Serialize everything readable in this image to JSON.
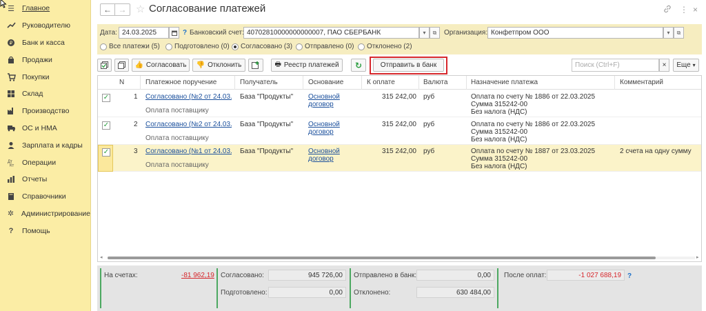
{
  "sidebar": {
    "items": [
      {
        "label": "Главное",
        "icon": "menu-icon"
      },
      {
        "label": "Руководителю",
        "icon": "trend-icon"
      },
      {
        "label": "Банк и касса",
        "icon": "bank-icon"
      },
      {
        "label": "Продажи",
        "icon": "bag-icon"
      },
      {
        "label": "Покупки",
        "icon": "cart-icon"
      },
      {
        "label": "Склад",
        "icon": "warehouse-icon"
      },
      {
        "label": "Производство",
        "icon": "factory-icon"
      },
      {
        "label": "ОС и НМА",
        "icon": "truck-icon"
      },
      {
        "label": "Зарплата и кадры",
        "icon": "person-icon"
      },
      {
        "label": "Операции",
        "icon": "operations-icon"
      },
      {
        "label": "Отчеты",
        "icon": "chart-icon"
      },
      {
        "label": "Справочники",
        "icon": "book-icon"
      },
      {
        "label": "Администрирование",
        "icon": "gear-icon"
      },
      {
        "label": "Помощь",
        "icon": "question-icon"
      }
    ]
  },
  "header": {
    "title": "Согласование платежей",
    "back": "←",
    "forward": "→",
    "star": "☆",
    "link_glyph": "🔗",
    "more_glyph": "⋮",
    "close_glyph": "×"
  },
  "filter": {
    "date_label": "Дата:",
    "date_value": "24.03.2025",
    "help": "?",
    "account_label": "Банковский счет:",
    "account_value": "40702810000000000007, ПАО СБЕРБАНК",
    "org_label": "Организация:",
    "org_value": "Конфетпром ООО",
    "radios": [
      {
        "label": "Все платежи (5)",
        "selected": false
      },
      {
        "label": "Подготовлено (0)",
        "selected": false
      },
      {
        "label": "Согласовано (3)",
        "selected": true
      },
      {
        "label": "Отправлено (0)",
        "selected": false
      },
      {
        "label": "Отклонено (2)",
        "selected": false
      }
    ]
  },
  "toolbar": {
    "approve": "Согласовать",
    "reject": "Отклонить",
    "registry": "Реестр платежей",
    "send_bank": "Отправить в банк",
    "search_placeholder": "Поиск (Ctrl+F)",
    "search_clear": "×",
    "more": "Еще"
  },
  "table": {
    "headers": {
      "n": "N",
      "order": "Платежное поручение",
      "recipient": "Получатель",
      "basis": "Основание",
      "amount": "К оплате",
      "currency": "Валюта",
      "purpose": "Назначение платежа",
      "comment": "Комментарий"
    },
    "rows": [
      {
        "checked": true,
        "n": "1",
        "order": "Согласовано (№2 от 24.03....",
        "order_sub": "Оплата поставщику",
        "recipient": "База \"Продукты\"",
        "basis1": "Основной",
        "basis2": "договор",
        "amount": "315 242,00",
        "currency": "руб",
        "purpose1": "Оплата по счету № 1886 от 22.03.2025",
        "purpose2": "Сумма 315242-00",
        "purpose3": "Без налога (НДС)",
        "comment": ""
      },
      {
        "checked": true,
        "n": "2",
        "order": "Согласовано (№2 от 24.03....",
        "order_sub": "Оплата поставщику",
        "recipient": "База \"Продукты\"",
        "basis1": "Основной",
        "basis2": "договор",
        "amount": "315 242,00",
        "currency": "руб",
        "purpose1": "Оплата по счету № 1886 от 22.03.2025",
        "purpose2": "Сумма 315242-00",
        "purpose3": "Без налога (НДС)",
        "comment": ""
      },
      {
        "checked": true,
        "n": "3",
        "order": "Согласовано (№1 от 24.03....",
        "order_sub": "Оплата поставщику",
        "recipient": "База \"Продукты\"",
        "basis1": "Основной",
        "basis2": "договор",
        "amount": "315 242,00",
        "currency": "руб",
        "purpose1": "Оплата по счету № 1887 от 23.03.2025",
        "purpose2": "Сумма 315242-00",
        "purpose3": "Без налога (НДС)",
        "comment": "2 счета на одну сумму"
      }
    ]
  },
  "footer": {
    "accounts_label": "На счетах:",
    "accounts_value": "-81 962,19",
    "approved_label": "Согласовано:",
    "approved_value": "945 726,00",
    "prepared_label": "Подготовлено:",
    "prepared_value": "0,00",
    "sent_label": "Отправлено в банк:",
    "sent_value": "0,00",
    "rejected_label": "Отклонено:",
    "rejected_value": "630 484,00",
    "after_label": "После оплат:",
    "after_value": "-1 027 688,19",
    "help": "?"
  },
  "colors": {
    "sidebar_bg": "#fbeda5",
    "filter_bg": "#f6edc0",
    "selected_row": "#fbf3c9",
    "highlight": "#d6262b",
    "negative": "#d6262b",
    "accent_green": "#4ba860"
  }
}
